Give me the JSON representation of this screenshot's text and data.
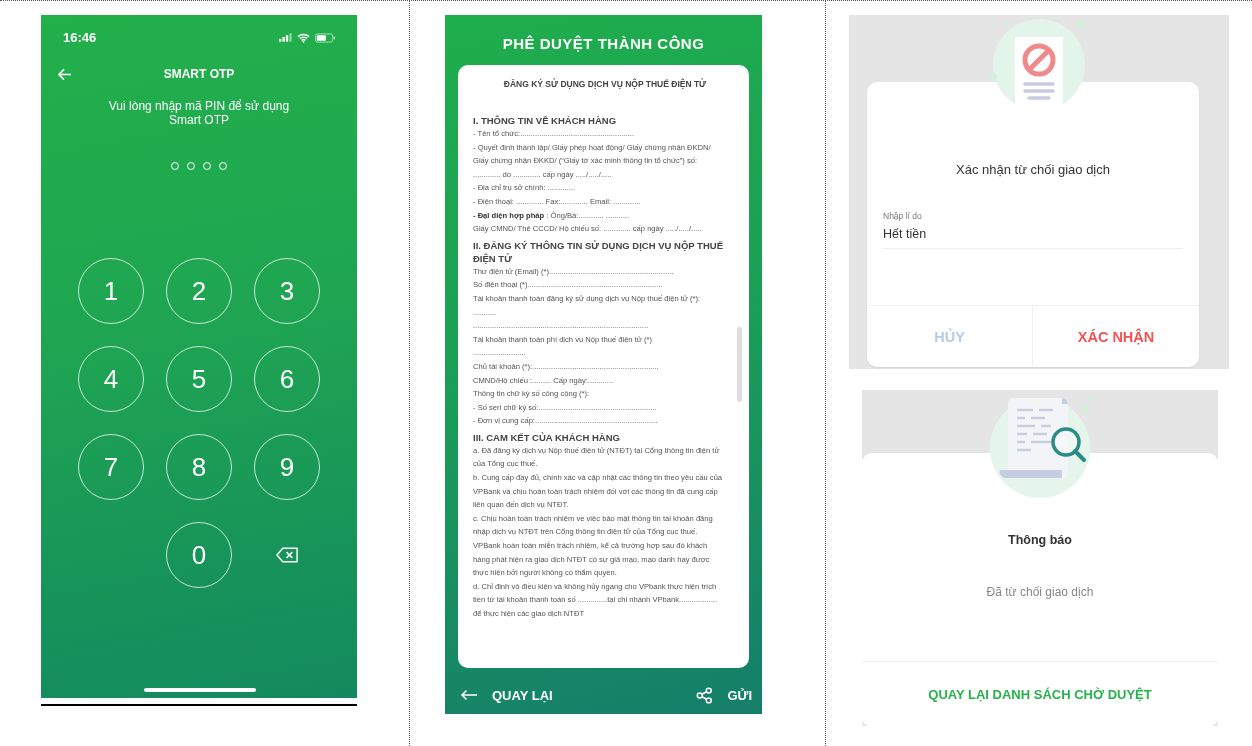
{
  "otp_screen": {
    "status_bar": {
      "time": "16:46"
    },
    "title": "SMART OTP",
    "instruction": "Vui lòng nhập mã PIN để sử dụng Smart OTP",
    "pin_dots": [
      {
        "filled": false
      },
      {
        "filled": false
      },
      {
        "filled": false
      },
      {
        "filled": false
      }
    ],
    "keys": [
      {
        "kind": "digit",
        "label": "1"
      },
      {
        "kind": "digit",
        "label": "2"
      },
      {
        "kind": "digit",
        "label": "3"
      },
      {
        "kind": "digit",
        "label": "4"
      },
      {
        "kind": "digit",
        "label": "5"
      },
      {
        "kind": "digit",
        "label": "6"
      },
      {
        "kind": "digit",
        "label": "7"
      },
      {
        "kind": "digit",
        "label": "8"
      },
      {
        "kind": "digit",
        "label": "9"
      },
      {
        "kind": "digit",
        "label": "0"
      },
      {
        "kind": "backspace"
      }
    ]
  },
  "approval_screen": {
    "title": "PHÊ DUYỆT THÀNH CÔNG",
    "document": [
      {
        "kind": "title",
        "text": "ĐĂNG KÝ SỬ DỤNG DỊCH VỤ NỘP THUẾ ĐIỆN TỬ"
      },
      {
        "kind": "heading",
        "text": "I. THÔNG TIN VỀ KHÁCH HÀNG"
      },
      {
        "kind": "line",
        "text": "- Tên tổ chức:......................................................"
      },
      {
        "kind": "line",
        "text": "- Quyết định thành lập/ Giấy phép hoạt động/ Giấy chứng nhận ĐKDN/ Giấy chứng nhận ĐKKD/ (“Giấy tờ xác minh thông tin tổ chức”) số: ............. do ............. cấp ngày ...../...../....."
      },
      {
        "kind": "line",
        "text": "- Địa chỉ trụ sở chính: ............."
      },
      {
        "kind": "line",
        "text": "- Điện thoại: ............. Fax:............. Email: ............."
      },
      {
        "kind": "line",
        "text": "**- Đại diện hợp pháp** : Ông/Bà:............ ..........."
      },
      {
        "kind": "line",
        "text": "Giấy CMND/ Thẻ CCCD/ Hộ chiếu số: ............. cấp ngày ...../...../....."
      },
      {
        "kind": "heading",
        "text": "II. ĐĂNG KÝ THÔNG TIN SỬ DỤNG DỊCH VỤ NỘP THUẾ ĐIỆN TỬ"
      },
      {
        "kind": "line",
        "text": "Thư điện tử (Email) (*)..........................................................."
      },
      {
        "kind": "line",
        "text": "Số điện thoại (*)................................................................"
      },
      {
        "kind": "line",
        "text": "Tài khoản thanh toán đăng ký sử dụng dịch vụ Nộp thuế điện tử (*): ..........."
      },
      {
        "kind": "line",
        "text": "..................................................................................."
      },
      {
        "kind": "line",
        "text": "Tài khoản thanh toán phí dịch vụ Nộp thuế điện tử (*)"
      },
      {
        "kind": "line",
        "text": "........................."
      },
      {
        "kind": "line",
        "text": "Chủ tài khoản (*):............................................................"
      },
      {
        "kind": "line",
        "text": "CMND/Hộ chiếu :......... Cấp ngày:............"
      },
      {
        "kind": "line",
        "text": "Thông tin chữ ký số công cộng (*):"
      },
      {
        "kind": "line",
        "text": "- Số seri chữ ký số:........................................................"
      },
      {
        "kind": "line",
        "text": "- Đơn vị cung cấp:.........................................................."
      },
      {
        "kind": "heading",
        "text": "III.  CAM KẾT CỦA KHÁCH HÀNG"
      },
      {
        "kind": "line",
        "text": "a. Đã đăng ký dịch vụ Nộp thuế điện tử (NTĐT) tại Cổng thông tin điện tử của Tổng cục thuế."
      },
      {
        "kind": "line",
        "text": "b. Cung cấp đầy đủ, chính xác và cập nhật các thông tin theo yêu cầu của VPBank  và chịu hoàn toàn trách nhiệm đối với các thông tin đã cung cấp liên quan đến dịch vụ NTĐT."
      },
      {
        "kind": "line",
        "text": "c. Chịu hoàn toàn trách nhiệm về việc bảo mật thông tin tài khoản đăng nhập dịch vụ NTĐT trên Cổng thông tin điện tử của Tổng cục thuế. VPBank hoàn toàn miễn trách nhiệm, kể cả trường hợp sau đó khách hàng phát hiện ra giao dịch NTĐT có sự giả mạo, mạo danh hay được thực hiện bởi người không có thẩm quyền."
      },
      {
        "kind": "line",
        "text": "d. Chỉ định vô điều kiện và không hủy ngang cho VPbank thực hiện trích tiền từ tài khoản thanh toán số ..............tại chi nhánh VPbank.................. để thực hiện các giao dịch NTĐT"
      }
    ],
    "back_label": "QUAY LẠI",
    "send_label": "GỬI"
  },
  "reject_dialog": {
    "title": "Xác nhận từ chối giao dịch",
    "field": {
      "label": "Nhập lí do",
      "value": "Hết tiền"
    },
    "buttons": [
      {
        "kind": "cancel",
        "label": "HỦY"
      },
      {
        "kind": "confirm",
        "label": "XÁC NHẬN"
      }
    ]
  },
  "notice_dialog": {
    "title": "Thông báo",
    "message": "Đã từ chối giao dịch",
    "button": "QUAY LẠI DANH SÁCH CHỜ DUYỆT"
  }
}
